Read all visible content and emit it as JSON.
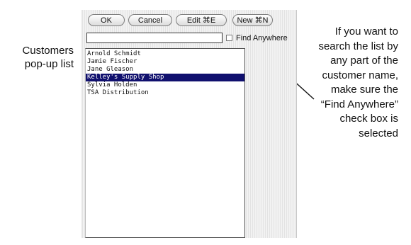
{
  "captions": {
    "left": "Customers pop-up list",
    "right": "If you want to search the list by any part of the customer name, make sure the “Find Anywhere” check box is selected"
  },
  "toolbar": {
    "ok_label": "OK",
    "cancel_label": "Cancel",
    "edit_label": "Edit ⌘E",
    "new_label": "New ⌘N"
  },
  "search": {
    "value": "",
    "placeholder": ""
  },
  "find_anywhere": {
    "label": "Find Anywhere",
    "checked": false
  },
  "customers": [
    {
      "name": "Arnold Schmidt",
      "selected": false
    },
    {
      "name": "Jamie Fischer",
      "selected": false
    },
    {
      "name": "Jane Gleason",
      "selected": false
    },
    {
      "name": "Kelley's Supply Shop",
      "selected": true
    },
    {
      "name": "Sylvia Holden",
      "selected": false
    },
    {
      "name": "TSA Distribution",
      "selected": false
    }
  ],
  "colors": {
    "selection": "#10106e",
    "popup_bg": "#eeeeee"
  }
}
